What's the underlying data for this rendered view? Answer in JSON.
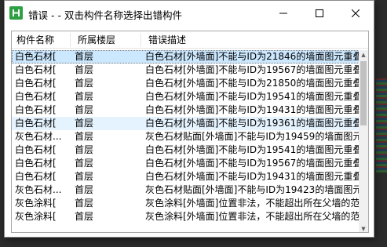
{
  "window": {
    "title": "错误 - - 双击构件名称选择出错构件",
    "minimize_glyph": "—",
    "maximize_glyph": "☐",
    "close_glyph": "✕"
  },
  "columns": [
    "构件名称",
    "所属楼层",
    "错误描述"
  ],
  "rows": [
    {
      "name": "白色石材[",
      "floor": "首层",
      "desc": "白色石材[外墙面]不能与ID为21846的墙面图元重叠...",
      "state": "selected"
    },
    {
      "name": "白色石材[",
      "floor": "首层",
      "desc": "白色石材[外墙面]不能与ID为19567的墙面图元重叠...",
      "state": ""
    },
    {
      "name": "白色石材[",
      "floor": "首层",
      "desc": "白色石材[外墙面]不能与ID为21850的墙面图元重叠...",
      "state": ""
    },
    {
      "name": "白色石材[",
      "floor": "首层",
      "desc": "白色石材[外墙面]不能与ID为19541的墙面图元重叠...",
      "state": ""
    },
    {
      "name": "白色石材[",
      "floor": "首层",
      "desc": "白色石材[外墙面]不能与ID为19431的墙面图元重叠...",
      "state": ""
    },
    {
      "name": "白色石材[",
      "floor": "首层",
      "desc": "白色石材[外墙面]不能与ID为19361的墙面图元重叠...",
      "state": "hover"
    },
    {
      "name": "灰色石材...",
      "floor": "首层",
      "desc": "灰色石材贴面[外墙面]不能与ID为19459的墙面图元...",
      "state": ""
    },
    {
      "name": "白色石材[",
      "floor": "首层",
      "desc": "白色石材[外墙面]不能与ID为19541的墙面图元重叠...",
      "state": ""
    },
    {
      "name": "白色石材[",
      "floor": "首层",
      "desc": "白色石材[外墙面]不能与ID为19567的墙面图元重叠...",
      "state": ""
    },
    {
      "name": "白色石材[",
      "floor": "首层",
      "desc": "白色石材[外墙面]不能与ID为19431的墙面图元重叠...",
      "state": ""
    },
    {
      "name": "灰色石材...",
      "floor": "首层",
      "desc": "灰色石材贴面[外墙面]不能与ID为19423的墙面图元...",
      "state": ""
    },
    {
      "name": "灰色涂料[",
      "floor": "首层",
      "desc": "灰色涂料[外墙面]位置非法，不能超出所在父墙的范...",
      "state": ""
    },
    {
      "name": "灰色涂料[",
      "floor": "首层",
      "desc": "灰色涂料[外墙面]位置非法，不能超出所在父墙的范...",
      "state": ""
    }
  ],
  "colors": {
    "selected_row": "#cce8ff",
    "hover_row": "#e5f3ff",
    "app_icon": "#2ea043"
  },
  "icons": {
    "app": "app-logo-icon",
    "scroll_up": "scroll-up-arrow-icon",
    "scroll_down": "scroll-down-arrow-icon"
  }
}
